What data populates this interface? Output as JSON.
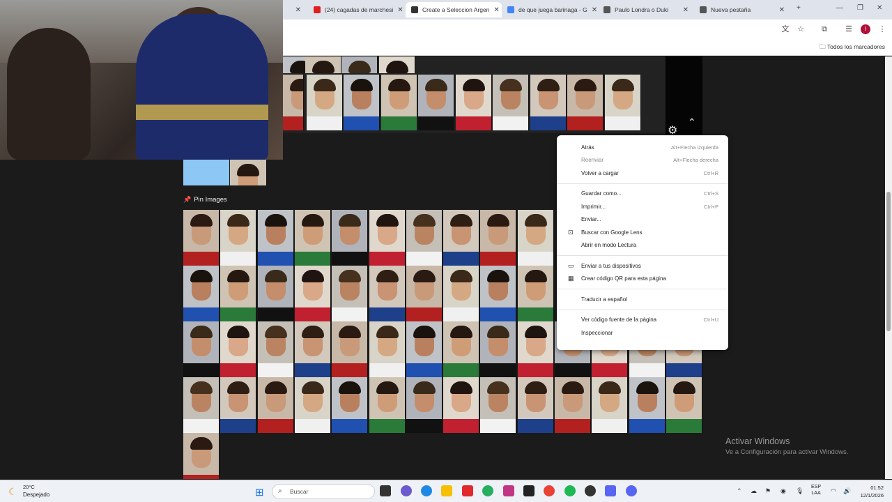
{
  "browser": {
    "tabs": [
      {
        "label": "(24) cagadas de marchesi",
        "active": false,
        "favicon_color": "#e02020"
      },
      {
        "label": "Create a Seleccion Argen",
        "active": true,
        "favicon_color": "#333333"
      },
      {
        "label": "de que juega barinaga - G",
        "active": false,
        "favicon_color": "#4285f4"
      },
      {
        "label": "Paulo Londra o Duki",
        "active": false,
        "favicon_color": "#555555"
      },
      {
        "label": "Nueva pestaña",
        "active": false,
        "favicon_color": "#555555"
      }
    ],
    "new_tab": "+",
    "bookmarks_all": "Todos los marcadores"
  },
  "page": {
    "pin_section_title": "Pin Images"
  },
  "context_menu": {
    "items": [
      {
        "label": "Atrás",
        "shortcut": "Alt+Flecha izquierda",
        "disabled": false,
        "icon": ""
      },
      {
        "label": "Reenviar",
        "shortcut": "Alt+Flecha derecha",
        "disabled": true,
        "icon": ""
      },
      {
        "label": "Volver a cargar",
        "shortcut": "Ctrl+R",
        "disabled": false,
        "icon": ""
      },
      {
        "sep": true
      },
      {
        "label": "Guardar como...",
        "shortcut": "Ctrl+S",
        "disabled": false,
        "icon": ""
      },
      {
        "label": "Imprimir...",
        "shortcut": "Ctrl+P",
        "disabled": false,
        "icon": ""
      },
      {
        "label": "Enviar...",
        "shortcut": "",
        "disabled": false,
        "icon": ""
      },
      {
        "label": "Buscar con Google Lens",
        "shortcut": "",
        "disabled": false,
        "icon": "lens-icon"
      },
      {
        "label": "Abrir en modo Lectura",
        "shortcut": "",
        "disabled": false,
        "icon": ""
      },
      {
        "sep": true
      },
      {
        "label": "Enviar a tus dispositivos",
        "shortcut": "",
        "disabled": false,
        "icon": "devices-icon"
      },
      {
        "label": "Crear código QR para esta página",
        "shortcut": "",
        "disabled": false,
        "icon": "qr-icon"
      },
      {
        "sep": true
      },
      {
        "label": "Traducir a español",
        "shortcut": "",
        "disabled": false,
        "icon": ""
      },
      {
        "sep": true
      },
      {
        "label": "Ver código fuente de la página",
        "shortcut": "Ctrl+U",
        "disabled": false,
        "icon": ""
      },
      {
        "label": "Inspeccionar",
        "shortcut": "",
        "disabled": false,
        "icon": ""
      }
    ]
  },
  "watermark": {
    "title": "Activar Windows",
    "subtitle": "Ve a Configuración para activar Windows."
  },
  "taskbar": {
    "weather_temp": "20°C",
    "weather_desc": "Despejado",
    "search_placeholder": "Buscar",
    "lang_top": "ESP",
    "lang_bottom": "LAA",
    "time": "01:52",
    "date": "12/1/2026"
  }
}
